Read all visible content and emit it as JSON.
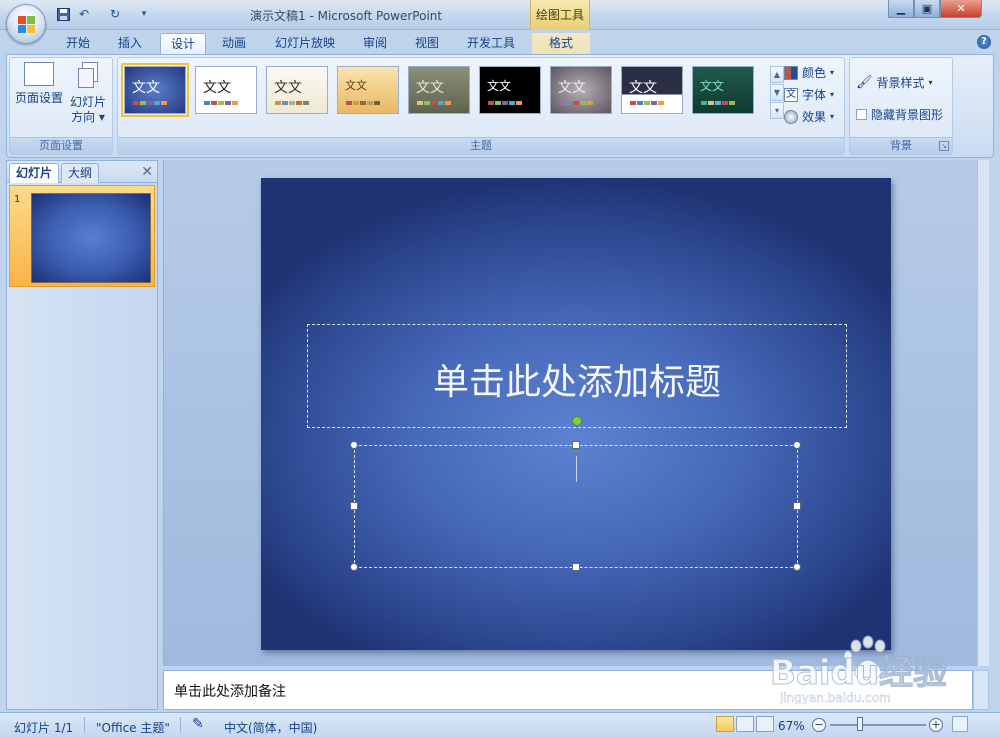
{
  "app": {
    "window_title": "演示文稿1 - Microsoft PowerPoint",
    "contextual_tab_title": "绘图工具"
  },
  "quick_access": [
    "save-icon",
    "undo-icon",
    "redo-icon",
    "customize-icon"
  ],
  "ribbon_tabs": [
    {
      "label": "开始"
    },
    {
      "label": "插入"
    },
    {
      "label": "设计",
      "active": true
    },
    {
      "label": "动画"
    },
    {
      "label": "幻灯片放映"
    },
    {
      "label": "审阅"
    },
    {
      "label": "视图"
    },
    {
      "label": "开发工具"
    },
    {
      "label": "格式",
      "contextual": true
    }
  ],
  "ribbon": {
    "page_setup": {
      "group_label": "页面设置",
      "page_setup_label": "页面设置",
      "orientation_label_line1": "幻灯片",
      "orientation_label_line2": "方向"
    },
    "themes": {
      "group_label": "主题",
      "theme_text": "文文",
      "colors_label": "颜色",
      "fonts_label": "字体",
      "effects_label": "效果"
    },
    "background": {
      "group_label": "背景",
      "styles_label": "背景样式",
      "hide_graphics_label": "隐藏背景图形"
    }
  },
  "left_pane": {
    "tab_slides": "幻灯片",
    "tab_outline": "大纲",
    "slide_number": "1"
  },
  "slide": {
    "title_placeholder": "单击此处添加标题"
  },
  "notes": {
    "placeholder": "单击此处添加备注"
  },
  "status_bar": {
    "slide_info": "幻灯片 1/1",
    "theme_name": "\"Office 主题\"",
    "language": "中文(简体，中国)",
    "zoom": "67%"
  },
  "watermark": {
    "text": "Baidu经验",
    "url": "jingyan.baidu.com"
  },
  "colors": {
    "slide_center": "#5e82d2",
    "slide_edge": "#1f3373",
    "ribbon_text": "#15428b"
  }
}
